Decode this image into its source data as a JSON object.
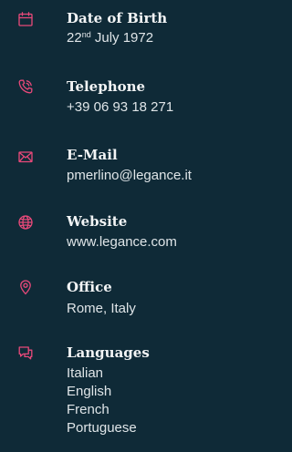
{
  "theme": {
    "background": "#0f2a37",
    "accent": "#e8497a",
    "label_color": "#f2f4f5",
    "value_color": "#dfe5e8"
  },
  "birth": {
    "icon": "calendar-icon",
    "label": "Date of Birth",
    "day": "22",
    "day_suffix": "nd",
    "rest": " July 1972"
  },
  "phone": {
    "icon": "phone-icon",
    "label": "Telephone",
    "value": "+39 06 93 18 271"
  },
  "email": {
    "icon": "envelope-icon",
    "label": "E-Mail",
    "value": "pmerlino@legance.it"
  },
  "website": {
    "icon": "globe-icon",
    "label": "Website",
    "value": "www.legance.com"
  },
  "office": {
    "icon": "map-pin-icon",
    "label": "Office",
    "value": "Rome, Italy"
  },
  "languages": {
    "icon": "chat-bubbles-icon",
    "label": "Languages",
    "items": [
      "Italian",
      "English",
      "French",
      "Portuguese"
    ]
  }
}
